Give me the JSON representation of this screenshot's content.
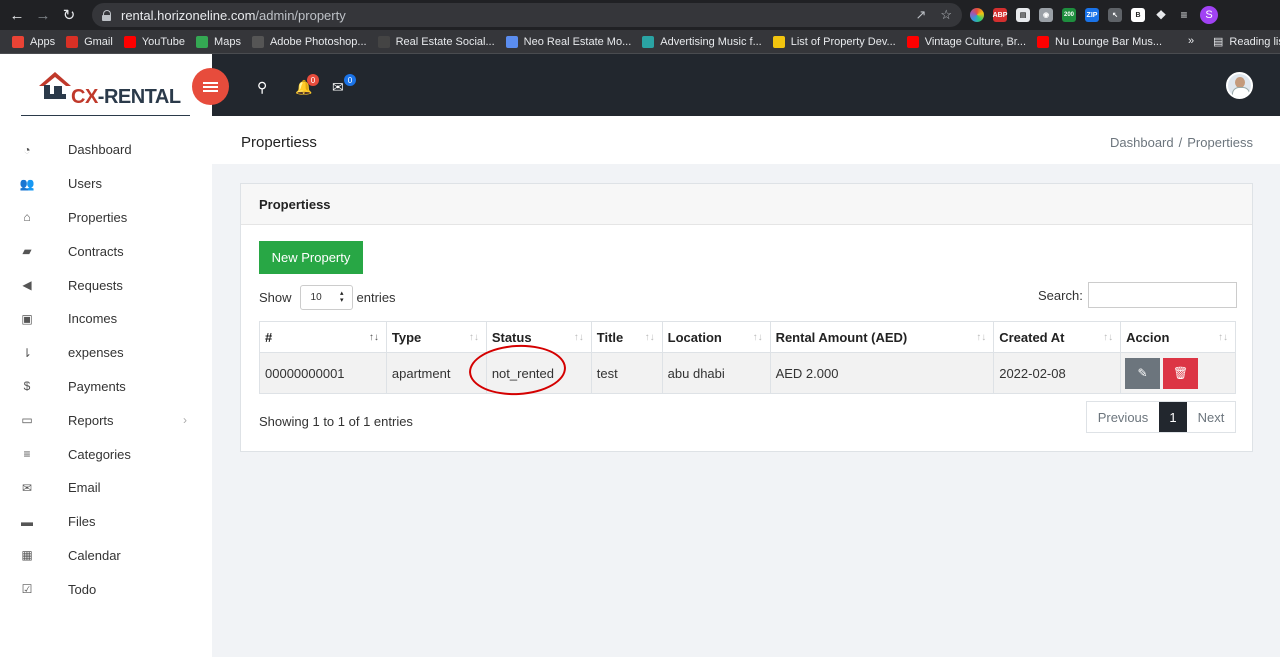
{
  "browser": {
    "url_host": "rental.horizoneline.com",
    "url_path": "/admin/property",
    "bookmarks": [
      {
        "label": "Apps",
        "color": "#ea4335"
      },
      {
        "label": "Gmail",
        "color": "#d93025"
      },
      {
        "label": "YouTube",
        "color": "#ff0000"
      },
      {
        "label": "Maps",
        "color": "#34a853"
      },
      {
        "label": "Adobe Photoshop...",
        "color": "#555555"
      },
      {
        "label": "Real Estate Social...",
        "color": "#444444"
      },
      {
        "label": "Neo Real Estate Mo...",
        "color": "#5b8def"
      },
      {
        "label": "Advertising Music f...",
        "color": "#2aa3a3"
      },
      {
        "label": "List of Property Dev...",
        "color": "#f1c40f"
      },
      {
        "label": "Vintage Culture, Br...",
        "color": "#ff0000"
      },
      {
        "label": "Nu Lounge Bar Mus...",
        "color": "#ff0000"
      }
    ],
    "more": "»",
    "reading_list": "Reading lis",
    "ext_badge": "200",
    "profile_initial": "S"
  },
  "brand": {
    "cx": "CX",
    "rest": "-RENTAL"
  },
  "sidebar": {
    "items": [
      {
        "label": "Dashboard",
        "icon": "dashboard-icon",
        "glyph": "◔"
      },
      {
        "label": "Users",
        "icon": "users-icon",
        "glyph": "👥"
      },
      {
        "label": "Properties",
        "icon": "home-icon",
        "glyph": "⌂"
      },
      {
        "label": "Contracts",
        "icon": "book-icon",
        "glyph": "▰"
      },
      {
        "label": "Requests",
        "icon": "bullhorn-icon",
        "glyph": "◀"
      },
      {
        "label": "Incomes",
        "icon": "money-icon",
        "glyph": "▣"
      },
      {
        "label": "expenses",
        "icon": "sort-amount-icon",
        "glyph": "⇂"
      },
      {
        "label": "Payments",
        "icon": "dollar-icon",
        "glyph": "$"
      },
      {
        "label": "Reports",
        "icon": "inbox-icon",
        "glyph": "▭"
      },
      {
        "label": "Categories",
        "icon": "bars-icon",
        "glyph": "≡"
      },
      {
        "label": "Email",
        "icon": "envelope-icon",
        "glyph": "✉"
      },
      {
        "label": "Files",
        "icon": "folder-icon",
        "glyph": "▬"
      },
      {
        "label": "Calendar",
        "icon": "calendar-icon",
        "glyph": "▦"
      },
      {
        "label": "Todo",
        "icon": "check-square-icon",
        "glyph": "☑"
      }
    ],
    "reports_chevron": "›"
  },
  "topbar": {
    "notifications": "0",
    "messages": "0"
  },
  "page": {
    "title": "Propertiess",
    "breadcrumb": [
      "Dashboard",
      "/",
      "Propertiess"
    ]
  },
  "card": {
    "title": "Propertiess",
    "new_button": "New Property",
    "show_label": "Show",
    "entries_value": "10",
    "entries_label": "entries",
    "search_label": "Search:",
    "columns": [
      "#",
      "Type",
      "Status",
      "Title",
      "Location",
      "Rental Amount (AED)",
      "Created At",
      "Accion"
    ],
    "rows": [
      {
        "id": "00000000001",
        "type": "apartment",
        "status": "not_rented",
        "title": "test",
        "location": "abu dhabi",
        "amount": "AED 2.000",
        "created": "2022-02-08"
      }
    ],
    "info": "Showing 1 to 1 of 1 entries",
    "pagination": {
      "previous": "Previous",
      "current": "1",
      "next": "Next"
    }
  },
  "colors": {
    "accent": "#e74c3c",
    "success": "#28a745",
    "danger": "#dc3545",
    "dark": "#22272e"
  }
}
